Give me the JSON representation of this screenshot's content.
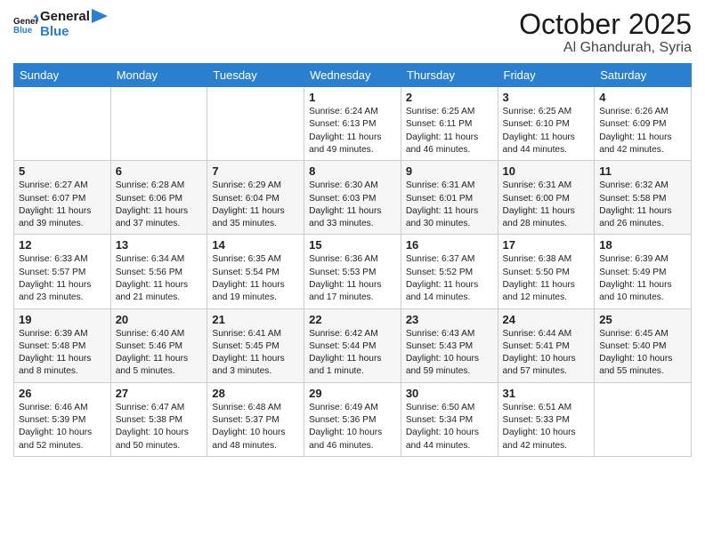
{
  "header": {
    "title": "October 2025",
    "location": "Al Ghandurah, Syria"
  },
  "weekdays": [
    "Sunday",
    "Monday",
    "Tuesday",
    "Wednesday",
    "Thursday",
    "Friday",
    "Saturday"
  ],
  "weeks": [
    [
      {
        "day": "",
        "info": ""
      },
      {
        "day": "",
        "info": ""
      },
      {
        "day": "",
        "info": ""
      },
      {
        "day": "1",
        "info": "Sunrise: 6:24 AM\nSunset: 6:13 PM\nDaylight: 11 hours\nand 49 minutes."
      },
      {
        "day": "2",
        "info": "Sunrise: 6:25 AM\nSunset: 6:11 PM\nDaylight: 11 hours\nand 46 minutes."
      },
      {
        "day": "3",
        "info": "Sunrise: 6:25 AM\nSunset: 6:10 PM\nDaylight: 11 hours\nand 44 minutes."
      },
      {
        "day": "4",
        "info": "Sunrise: 6:26 AM\nSunset: 6:09 PM\nDaylight: 11 hours\nand 42 minutes."
      }
    ],
    [
      {
        "day": "5",
        "info": "Sunrise: 6:27 AM\nSunset: 6:07 PM\nDaylight: 11 hours\nand 39 minutes."
      },
      {
        "day": "6",
        "info": "Sunrise: 6:28 AM\nSunset: 6:06 PM\nDaylight: 11 hours\nand 37 minutes."
      },
      {
        "day": "7",
        "info": "Sunrise: 6:29 AM\nSunset: 6:04 PM\nDaylight: 11 hours\nand 35 minutes."
      },
      {
        "day": "8",
        "info": "Sunrise: 6:30 AM\nSunset: 6:03 PM\nDaylight: 11 hours\nand 33 minutes."
      },
      {
        "day": "9",
        "info": "Sunrise: 6:31 AM\nSunset: 6:01 PM\nDaylight: 11 hours\nand 30 minutes."
      },
      {
        "day": "10",
        "info": "Sunrise: 6:31 AM\nSunset: 6:00 PM\nDaylight: 11 hours\nand 28 minutes."
      },
      {
        "day": "11",
        "info": "Sunrise: 6:32 AM\nSunset: 5:58 PM\nDaylight: 11 hours\nand 26 minutes."
      }
    ],
    [
      {
        "day": "12",
        "info": "Sunrise: 6:33 AM\nSunset: 5:57 PM\nDaylight: 11 hours\nand 23 minutes."
      },
      {
        "day": "13",
        "info": "Sunrise: 6:34 AM\nSunset: 5:56 PM\nDaylight: 11 hours\nand 21 minutes."
      },
      {
        "day": "14",
        "info": "Sunrise: 6:35 AM\nSunset: 5:54 PM\nDaylight: 11 hours\nand 19 minutes."
      },
      {
        "day": "15",
        "info": "Sunrise: 6:36 AM\nSunset: 5:53 PM\nDaylight: 11 hours\nand 17 minutes."
      },
      {
        "day": "16",
        "info": "Sunrise: 6:37 AM\nSunset: 5:52 PM\nDaylight: 11 hours\nand 14 minutes."
      },
      {
        "day": "17",
        "info": "Sunrise: 6:38 AM\nSunset: 5:50 PM\nDaylight: 11 hours\nand 12 minutes."
      },
      {
        "day": "18",
        "info": "Sunrise: 6:39 AM\nSunset: 5:49 PM\nDaylight: 11 hours\nand 10 minutes."
      }
    ],
    [
      {
        "day": "19",
        "info": "Sunrise: 6:39 AM\nSunset: 5:48 PM\nDaylight: 11 hours\nand 8 minutes."
      },
      {
        "day": "20",
        "info": "Sunrise: 6:40 AM\nSunset: 5:46 PM\nDaylight: 11 hours\nand 5 minutes."
      },
      {
        "day": "21",
        "info": "Sunrise: 6:41 AM\nSunset: 5:45 PM\nDaylight: 11 hours\nand 3 minutes."
      },
      {
        "day": "22",
        "info": "Sunrise: 6:42 AM\nSunset: 5:44 PM\nDaylight: 11 hours\nand 1 minute."
      },
      {
        "day": "23",
        "info": "Sunrise: 6:43 AM\nSunset: 5:43 PM\nDaylight: 10 hours\nand 59 minutes."
      },
      {
        "day": "24",
        "info": "Sunrise: 6:44 AM\nSunset: 5:41 PM\nDaylight: 10 hours\nand 57 minutes."
      },
      {
        "day": "25",
        "info": "Sunrise: 6:45 AM\nSunset: 5:40 PM\nDaylight: 10 hours\nand 55 minutes."
      }
    ],
    [
      {
        "day": "26",
        "info": "Sunrise: 6:46 AM\nSunset: 5:39 PM\nDaylight: 10 hours\nand 52 minutes."
      },
      {
        "day": "27",
        "info": "Sunrise: 6:47 AM\nSunset: 5:38 PM\nDaylight: 10 hours\nand 50 minutes."
      },
      {
        "day": "28",
        "info": "Sunrise: 6:48 AM\nSunset: 5:37 PM\nDaylight: 10 hours\nand 48 minutes."
      },
      {
        "day": "29",
        "info": "Sunrise: 6:49 AM\nSunset: 5:36 PM\nDaylight: 10 hours\nand 46 minutes."
      },
      {
        "day": "30",
        "info": "Sunrise: 6:50 AM\nSunset: 5:34 PM\nDaylight: 10 hours\nand 44 minutes."
      },
      {
        "day": "31",
        "info": "Sunrise: 6:51 AM\nSunset: 5:33 PM\nDaylight: 10 hours\nand 42 minutes."
      },
      {
        "day": "",
        "info": ""
      }
    ]
  ]
}
